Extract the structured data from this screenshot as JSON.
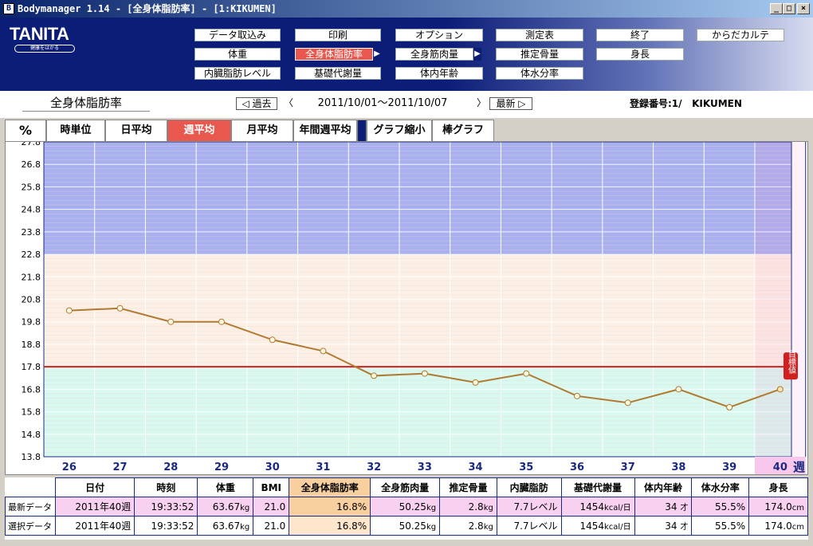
{
  "window": {
    "title": "Bodymanager 1.14 - [全身体脂肪率] - [1:KIKUMEN]"
  },
  "brand": {
    "logo": "TANITA",
    "tagline": "健康をはかる"
  },
  "menu": [
    {
      "label": "データ取込み"
    },
    {
      "label": "印刷"
    },
    {
      "label": "オプション"
    },
    {
      "label": "測定表"
    },
    {
      "label": "終了"
    },
    {
      "label": "からだカルテ"
    },
    {
      "label": "体重"
    },
    {
      "label": "全身体脂肪率",
      "active": true
    },
    {
      "label": "全身筋肉量"
    },
    {
      "label": "推定骨量"
    },
    {
      "label": "身長"
    },
    {
      "label": "内臓脂肪レベル"
    },
    {
      "label": "基礎代謝量"
    },
    {
      "label": "体内年齢"
    },
    {
      "label": "体水分率"
    }
  ],
  "subbar": {
    "chart_title": "全身体脂肪率",
    "prev": "過去",
    "next": "最新",
    "date_range": "2011/10/01〜2011/10/07",
    "registration": "登録番号:1/",
    "user": "KIKUMEN"
  },
  "tabs": {
    "unit": "%",
    "items": [
      "時単位",
      "日平均",
      "週平均",
      "月平均",
      "年間週平均",
      "グラフ縮小",
      "棒グラフ"
    ],
    "active": "週平均"
  },
  "chart_data": {
    "type": "line",
    "x": [
      26,
      27,
      28,
      29,
      30,
      31,
      32,
      33,
      34,
      35,
      36,
      37,
      38,
      39,
      40
    ],
    "values": [
      20.3,
      20.4,
      19.8,
      19.8,
      19.0,
      18.5,
      17.4,
      17.5,
      17.1,
      17.5,
      16.5,
      16.2,
      16.8,
      16.0,
      16.8
    ],
    "xlabel": "週",
    "ylim": [
      13.8,
      27.8
    ],
    "yticks": [
      "27.8",
      "26.8",
      "25.8",
      "24.8",
      "23.8",
      "22.8",
      "21.8",
      "20.8",
      "19.8",
      "18.8",
      "17.8",
      "16.8",
      "15.8",
      "14.8",
      "13.8"
    ],
    "target": 17.8,
    "target_label": "目標値",
    "bands": [
      {
        "from": 22.8,
        "to": 27.8,
        "color": "#a8b0f0"
      },
      {
        "from": 17.8,
        "to": 22.8,
        "color": "#fcf0e6"
      },
      {
        "from": 13.8,
        "to": 17.8,
        "color": "#d8f8f0"
      }
    ],
    "line_color": "#b07a30",
    "target_color": "#d02020"
  },
  "table": {
    "headers": [
      "日付",
      "時刻",
      "体重",
      "BMI",
      "全身体脂肪率",
      "全身筋肉量",
      "推定骨量",
      "内臓脂肪",
      "基礎代謝量",
      "体内年齢",
      "体水分率",
      "身長"
    ],
    "rows": [
      {
        "label": "最新データ",
        "date": "2011年40週",
        "time": "19:33:52",
        "weight": "63.67",
        "weight_unit": "kg",
        "bmi": "21.0",
        "fat": "16.8%",
        "muscle": "50.25",
        "muscle_unit": "kg",
        "bone": "2.8",
        "bone_unit": "kg",
        "visceral": "7.7レベル",
        "bmr": "1454",
        "bmr_unit": "kcal/日",
        "age": "34",
        "age_unit": "才",
        "water": "55.5%",
        "height": "174.0",
        "height_unit": "cm"
      },
      {
        "label": "選択データ",
        "date": "2011年40週",
        "time": "19:33:52",
        "weight": "63.67",
        "weight_unit": "kg",
        "bmi": "21.0",
        "fat": "16.8%",
        "muscle": "50.25",
        "muscle_unit": "kg",
        "bone": "2.8",
        "bone_unit": "kg",
        "visceral": "7.7レベル",
        "bmr": "1454",
        "bmr_unit": "kcal/日",
        "age": "34",
        "age_unit": "才",
        "water": "55.5%",
        "height": "174.0",
        "height_unit": "cm"
      }
    ]
  }
}
